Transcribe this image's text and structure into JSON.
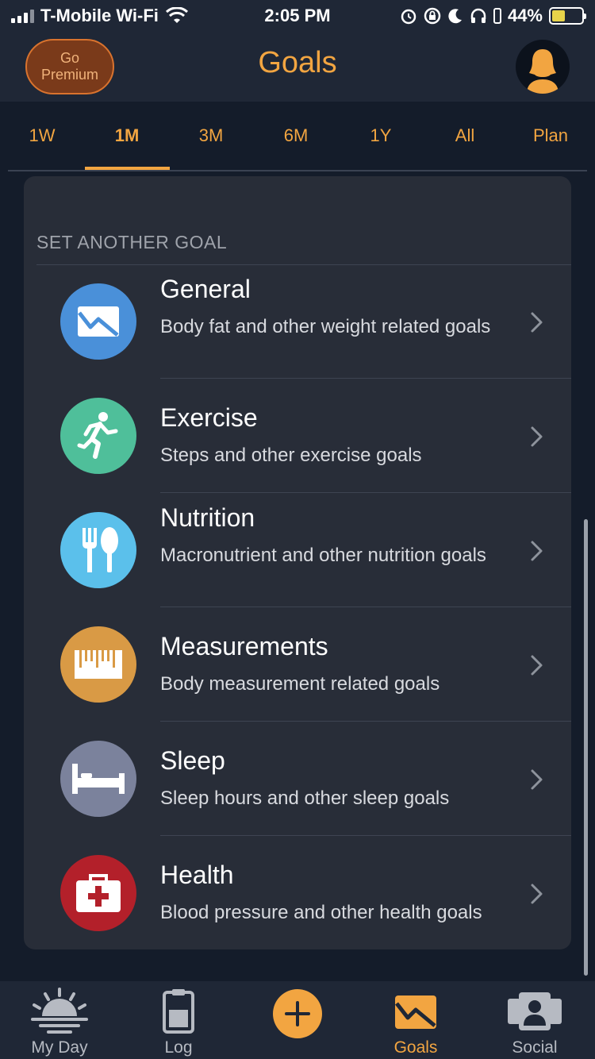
{
  "status_bar": {
    "carrier": "T-Mobile Wi-Fi",
    "time": "2:05 PM",
    "battery_percent": "44%",
    "battery_level": 0.44,
    "icons": [
      "signal-icon",
      "wifi-icon",
      "alarm-icon",
      "rotation-lock-icon",
      "moon-icon",
      "headphones-icon",
      "battery-icon"
    ]
  },
  "header": {
    "premium_label": "Go\nPremium",
    "title": "Goals",
    "avatar_icon": "user-avatar-icon"
  },
  "tabs": [
    {
      "label": "1W",
      "active": false
    },
    {
      "label": "1M",
      "active": true
    },
    {
      "label": "3M",
      "active": false
    },
    {
      "label": "6M",
      "active": false
    },
    {
      "label": "1Y",
      "active": false
    },
    {
      "label": "All",
      "active": false
    },
    {
      "label": "Plan",
      "active": false
    }
  ],
  "section": {
    "heading": "SET ANOTHER GOAL"
  },
  "goals": [
    {
      "title": "General",
      "description": "Body fat and other weight related goals",
      "icon": "envelope-chart-icon",
      "color": "#4a90d9"
    },
    {
      "title": "Exercise",
      "description": "Steps and other exercise goals",
      "icon": "running-person-icon",
      "color": "#4fbf9a"
    },
    {
      "title": "Nutrition",
      "description": "Macronutrient and other nutrition goals",
      "icon": "fork-spoon-icon",
      "color": "#5bc0eb"
    },
    {
      "title": "Measurements",
      "description": "Body measurement related goals",
      "icon": "ruler-icon",
      "color": "#d99a45"
    },
    {
      "title": "Sleep",
      "description": "Sleep hours and other sleep goals",
      "icon": "bed-icon",
      "color": "#7b829c"
    },
    {
      "title": "Health",
      "description": "Blood pressure and other health goals",
      "icon": "medical-kit-icon",
      "color": "#b3202a"
    }
  ],
  "bottom_nav": [
    {
      "label": "My Day",
      "icon": "sunrise-icon",
      "active": false
    },
    {
      "label": "Log",
      "icon": "clipboard-icon",
      "active": false
    },
    {
      "label": "",
      "icon": "add-icon",
      "active": false
    },
    {
      "label": "Goals",
      "icon": "goals-icon",
      "active": true
    },
    {
      "label": "Social",
      "icon": "social-icon",
      "active": false
    }
  ],
  "colors": {
    "accent": "#f2a541",
    "background": "#141c2a",
    "card": "#282d38",
    "header": "#1f2736"
  }
}
